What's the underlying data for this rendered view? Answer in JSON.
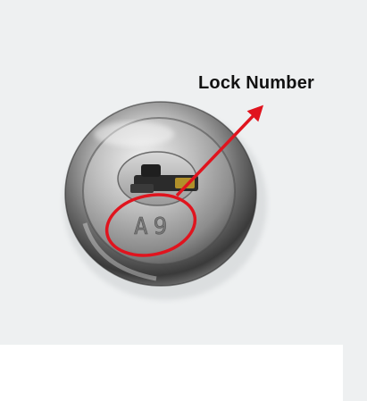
{
  "annotation": {
    "label": "Lock Number",
    "arrow_color": "#e0141e"
  },
  "lock": {
    "stamped_code": "A9"
  },
  "colors": {
    "background": "#eef0f1",
    "highlight": "#e0141e"
  }
}
